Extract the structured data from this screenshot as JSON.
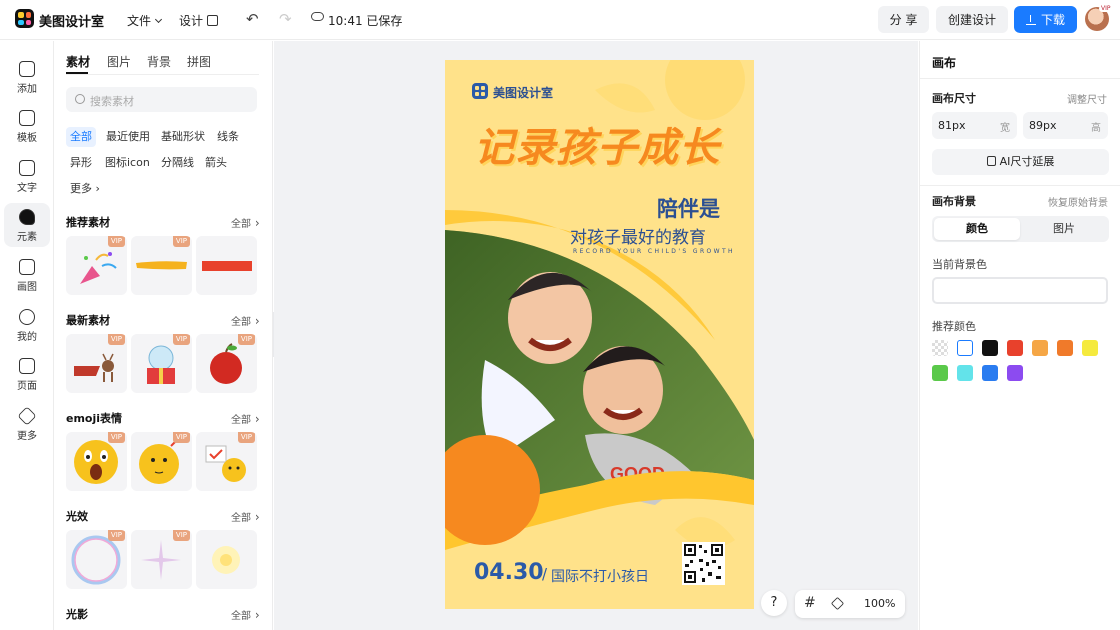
{
  "app": {
    "title": "美图设计室",
    "menu": {
      "file": "文件",
      "design": "设计"
    },
    "save_status": "10:41 已保存",
    "buttons": {
      "share": "分 享",
      "create": "创建设计",
      "download": "下载"
    },
    "avatar_badge": "VIP"
  },
  "rail": {
    "items": [
      {
        "label": "添加",
        "icon": "plus-square-icon"
      },
      {
        "label": "模板",
        "icon": "template-icon"
      },
      {
        "label": "文字",
        "icon": "text-icon"
      },
      {
        "label": "元素",
        "icon": "shapes-icon",
        "active": true
      },
      {
        "label": "画图",
        "icon": "draw-icon"
      },
      {
        "label": "我的",
        "icon": "user-icon"
      },
      {
        "label": "页面",
        "icon": "page-add-icon"
      },
      {
        "label": "更多",
        "icon": "cube-icon"
      }
    ]
  },
  "assets": {
    "tabs": [
      "素材",
      "图片",
      "背景",
      "拼图"
    ],
    "search_placeholder": "搜索素材",
    "chips": [
      "全部",
      "最近使用",
      "基础形状",
      "线条",
      "异形",
      "图标icon",
      "分隔线",
      "箭头",
      "更多"
    ],
    "all_label": "全部",
    "vip_label": "VIP",
    "sections": [
      "推荐素材",
      "最新素材",
      "emoji表情",
      "光效",
      "光影"
    ]
  },
  "poster": {
    "brand": "美图设计室",
    "headline": "记录孩子成长",
    "sub1": "陪伴是",
    "sub2": "对孩子最好的教育",
    "english": "RECORD YOUR CHILD'S GROWTH",
    "date": "04.30",
    "date_sep": "/",
    "holiday": "国际不打小孩日",
    "colors": {
      "bg": "#ffe28a",
      "orange": "#f6891f",
      "blue": "#2b4f92"
    }
  },
  "toolbar": {
    "help": "?",
    "zoom": "100%"
  },
  "properties": {
    "title": "画布",
    "size_label": "画布尺寸",
    "adjust_size": "调整尺寸",
    "width_value": "81px",
    "width_unit": "宽",
    "height_value": "89px",
    "height_unit": "高",
    "ai_extend": "AI尺寸延展",
    "bg_label": "画布背景",
    "reset_bg": "恢复原始背景",
    "seg_color": "颜色",
    "seg_image": "图片",
    "current_bg": "当前背景色",
    "recommended": "推荐颜色",
    "swatches": [
      "transparent",
      "#ffffff",
      "#111111",
      "#e8412c",
      "#f5a646",
      "#f07a2a",
      "#f5ea3e",
      "#5ac94a",
      "#63e3ea",
      "#2a7cf0",
      "#8c4bf0"
    ]
  }
}
